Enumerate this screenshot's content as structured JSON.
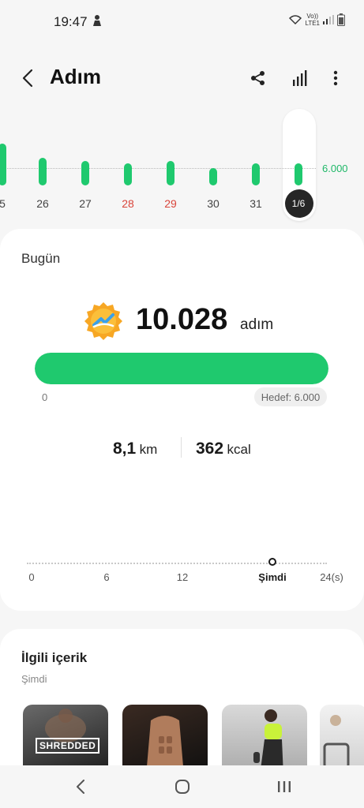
{
  "status": {
    "time": "19:47",
    "network_top": "Vo))",
    "network_bottom": "LTE1"
  },
  "header": {
    "title": "Adım"
  },
  "week": {
    "goal_label": "6.000",
    "days": [
      {
        "label": "5",
        "steps": 9000,
        "weekend": false,
        "selected": false
      },
      {
        "label": "26",
        "steps": 6000,
        "weekend": false,
        "selected": false
      },
      {
        "label": "27",
        "steps": 5200,
        "weekend": false,
        "selected": false
      },
      {
        "label": "28",
        "steps": 4800,
        "weekend": true,
        "selected": false
      },
      {
        "label": "29",
        "steps": 5300,
        "weekend": true,
        "selected": false
      },
      {
        "label": "30",
        "steps": 3700,
        "weekend": false,
        "selected": false
      },
      {
        "label": "31",
        "steps": 4700,
        "weekend": false,
        "selected": false
      },
      {
        "label": "1/6",
        "steps": 4700,
        "weekend": false,
        "selected": true
      }
    ]
  },
  "today": {
    "title": "Bugün",
    "steps": "10.028",
    "steps_unit": "adım",
    "progress_fraction": 1.0,
    "progress_min": "0",
    "goal_chip": "Hedef: 6.000",
    "distance_value": "8,1",
    "distance_unit": "km",
    "calories_value": "362",
    "calories_unit": "kcal"
  },
  "hourly": {
    "ticks": [
      "0",
      "6",
      "12",
      "Şimdi",
      "24(s)"
    ],
    "values": [
      0,
      0,
      0,
      0,
      0,
      0,
      0,
      0,
      0,
      0,
      0,
      0,
      0,
      0,
      0,
      0,
      0,
      0,
      0,
      0,
      0,
      0,
      0,
      0,
      0,
      0,
      0,
      0,
      0,
      0,
      0,
      0,
      0,
      0,
      0,
      0,
      0,
      0,
      0,
      0,
      0,
      0,
      0,
      0,
      0,
      0,
      0,
      0,
      0,
      0,
      0,
      0,
      0,
      0,
      0,
      0,
      0,
      0,
      0,
      0,
      0,
      0,
      0,
      0,
      0,
      0,
      0,
      0,
      0,
      0,
      0,
      0,
      0,
      0,
      0,
      0,
      0,
      0,
      0,
      0
    ]
  },
  "related": {
    "title": "İlgili içerik",
    "subtitle": "Şimdi",
    "items": [
      {
        "badge": "SHREDDED",
        "icon": "shredded-workout-thumbnail"
      },
      {
        "badge": "",
        "icon": "abs-workout-thumbnail"
      },
      {
        "badge": "",
        "icon": "fitness-woman-thumbnail"
      },
      {
        "badge": "",
        "icon": "gym-equipment-thumbnail"
      }
    ]
  },
  "colors": {
    "accent": "#1fc96e",
    "weekend": "#d9453b",
    "goal_text": "#1fb868"
  }
}
